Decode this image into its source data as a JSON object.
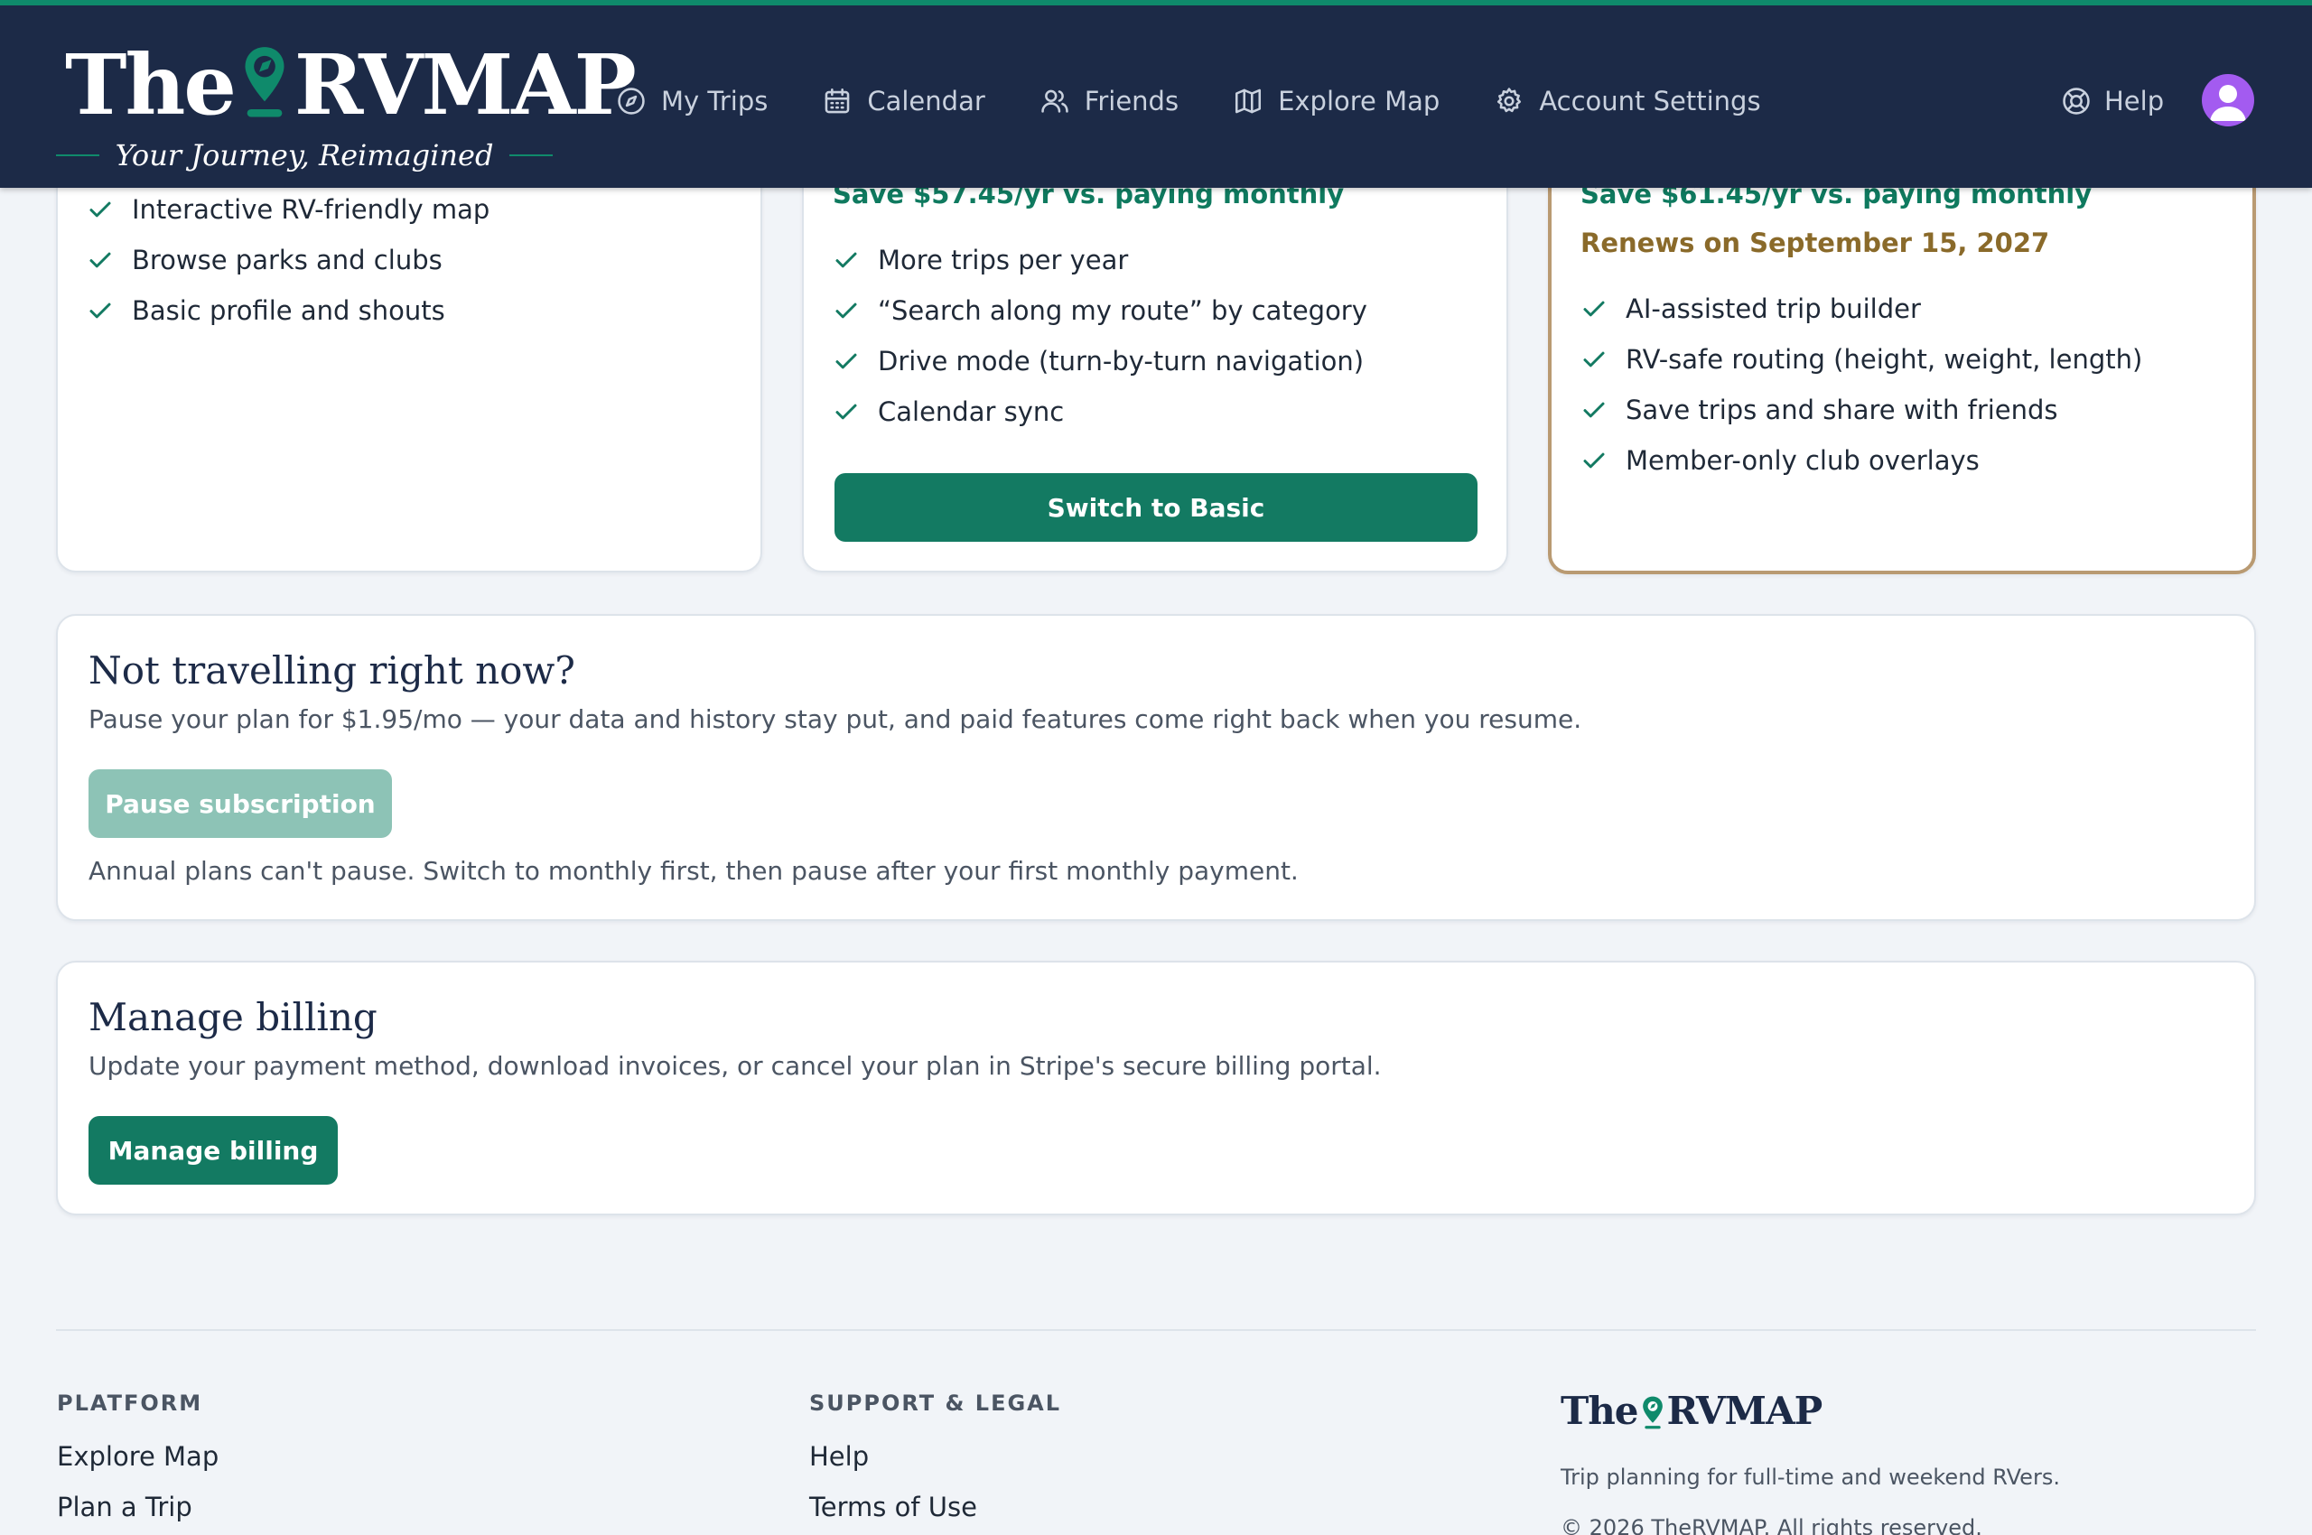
{
  "brand": {
    "name_prefix": "The",
    "name_main": "RVMAP",
    "tagline": "Your Journey, Reimagined",
    "accent": "#0f8a6b",
    "navy": "#1c2a47"
  },
  "nav": {
    "items": [
      {
        "label": "My Trips",
        "icon": "compass-icon"
      },
      {
        "label": "Calendar",
        "icon": "calendar-icon"
      },
      {
        "label": "Friends",
        "icon": "friends-icon"
      },
      {
        "label": "Explore Map",
        "icon": "map-icon"
      },
      {
        "label": "Account Settings",
        "icon": "gear-icon"
      }
    ],
    "help": "Help"
  },
  "plans": {
    "free": {
      "features": [
        "Interactive RV-friendly map",
        "Browse parks and clubs",
        "Basic profile and shouts"
      ]
    },
    "basic": {
      "savings": "Save $57.45/yr vs. paying monthly",
      "features": [
        "More trips per year",
        "“Search along my route” by category",
        "Drive mode (turn-by-turn navigation)",
        "Calendar sync"
      ],
      "button": "Switch to Basic"
    },
    "current": {
      "savings": "Save $61.45/yr vs. paying monthly",
      "renews": "Renews on September 15, 2027",
      "features": [
        "AI-assisted trip builder",
        "RV-safe routing (height, weight, length)",
        "Save trips and share with friends",
        "Member-only club overlays"
      ]
    }
  },
  "pause": {
    "title": "Not travelling right now?",
    "description": "Pause your plan for $1.95/mo — your data and history stay put, and paid features come right back when you resume.",
    "button": "Pause subscription",
    "note": "Annual plans can't pause. Switch to monthly first, then pause after your first monthly payment."
  },
  "billing": {
    "title": "Manage billing",
    "description": "Update your payment method, download invoices, or cancel your plan in Stripe's secure billing portal.",
    "button": "Manage billing"
  },
  "footer": {
    "platform_heading": "PLATFORM",
    "platform_links": [
      "Explore Map",
      "Plan a Trip"
    ],
    "support_heading": "SUPPORT & LEGAL",
    "support_links": [
      "Help",
      "Terms of Use"
    ],
    "brand_prefix": "The",
    "brand_main": "RVMAP",
    "blurb": "Trip planning for full-time and weekend RVers.",
    "copyright": "© 2026 TheRVMAP. All rights reserved."
  }
}
